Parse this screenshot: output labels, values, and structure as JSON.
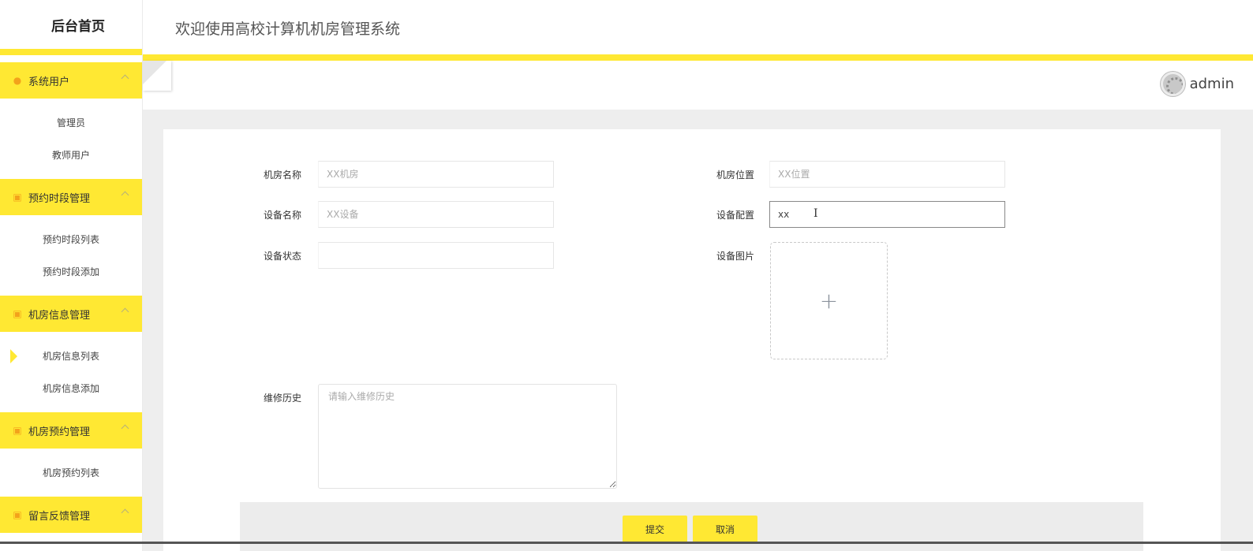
{
  "sidebar": {
    "brand": "后台首页",
    "groups": [
      {
        "label": "系统用户",
        "icon": "user-icon",
        "items": [
          "管理员",
          "教师用户"
        ]
      },
      {
        "label": "预约时段管理",
        "icon": "folder-icon",
        "items": [
          "预约时段列表",
          "预约时段添加"
        ]
      },
      {
        "label": "机房信息管理",
        "icon": "folder-icon",
        "items": [
          "机房信息列表",
          "机房信息添加"
        ],
        "active_item": 0
      },
      {
        "label": "机房预约管理",
        "icon": "folder-icon",
        "items": [
          "机房预约列表"
        ]
      },
      {
        "label": "留言反馈管理",
        "icon": "folder-icon",
        "items": []
      }
    ]
  },
  "header": {
    "title": "欢迎使用高校计算机机房管理系统"
  },
  "user": {
    "name": "admin"
  },
  "form": {
    "room_name": {
      "label": "机房名称",
      "placeholder": "XX机房",
      "value": ""
    },
    "room_location": {
      "label": "机房位置",
      "placeholder": "XX位置",
      "value": ""
    },
    "device_name": {
      "label": "设备名称",
      "placeholder": "XX设备",
      "value": ""
    },
    "device_config": {
      "label": "设备配置",
      "placeholder": "",
      "value": "xx"
    },
    "device_status": {
      "label": "设备状态",
      "value": ""
    },
    "device_image": {
      "label": "设备图片",
      "upload_symbol": "+"
    },
    "repair_history": {
      "label": "维修历史",
      "placeholder": "请输入维修历史",
      "value": ""
    }
  },
  "buttons": {
    "submit": "提交",
    "cancel": "取消"
  },
  "colors": {
    "accent": "#ffe833",
    "content_bg": "#eeeeee"
  }
}
